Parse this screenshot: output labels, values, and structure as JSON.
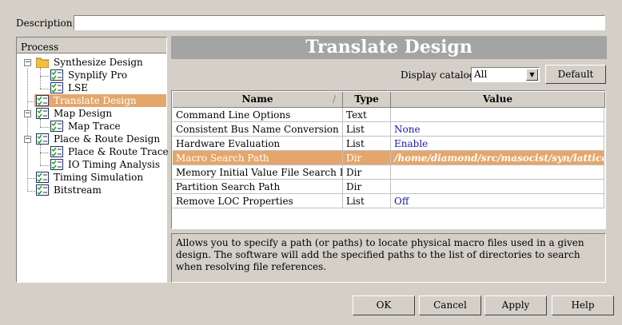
{
  "description": {
    "label": "Description:",
    "value": ""
  },
  "process": {
    "header": "Process",
    "items": [
      {
        "label": "Synthesize Design",
        "icon": "folder-icon"
      },
      {
        "label": "Synplify Pro",
        "icon": "checklist-icon"
      },
      {
        "label": "LSE",
        "icon": "checklist-icon"
      },
      {
        "label": "Translate Design",
        "icon": "checklist-icon",
        "selected": true
      },
      {
        "label": "Map Design",
        "icon": "checklist-icon"
      },
      {
        "label": "Map Trace",
        "icon": "checklist-icon"
      },
      {
        "label": "Place & Route Design",
        "icon": "checklist-icon"
      },
      {
        "label": "Place & Route Trace",
        "icon": "checklist-icon"
      },
      {
        "label": "IO Timing Analysis",
        "icon": "checklist-icon"
      },
      {
        "label": "Timing Simulation",
        "icon": "checklist-icon"
      },
      {
        "label": "Bitstream",
        "icon": "checklist-icon"
      }
    ],
    "expander_minus": "−"
  },
  "panel": {
    "title": "Translate Design",
    "catalog_label": "Display catalog:",
    "catalog_value": "All",
    "default_button": "Default"
  },
  "table": {
    "headers": [
      "Name",
      "Type",
      "Value"
    ],
    "rows": [
      {
        "name": "Command Line Options",
        "type": "Text",
        "value": ""
      },
      {
        "name": "Consistent Bus Name Conversion",
        "type": "List",
        "value": "None"
      },
      {
        "name": "Hardware Evaluation",
        "type": "List",
        "value": "Enable"
      },
      {
        "name": "Macro Search Path",
        "type": "Dir",
        "value": "/home/diamond/src/masocist/syn/lattice/ngo",
        "selected": true
      },
      {
        "name": "Memory Initial Value File Search Path",
        "type": "Dir",
        "value": ""
      },
      {
        "name": "Partition Search Path",
        "type": "Dir",
        "value": ""
      },
      {
        "name": "Remove LOC Properties",
        "type": "List",
        "value": "Off"
      }
    ]
  },
  "help_text": "Allows you to specify a path (or paths) to locate physical macro files used in a given design. The software will add the specified paths to the list of directories to search when resolving file references.",
  "buttons": {
    "ok": "OK",
    "cancel": "Cancel",
    "apply": "Apply",
    "help": "Help"
  }
}
